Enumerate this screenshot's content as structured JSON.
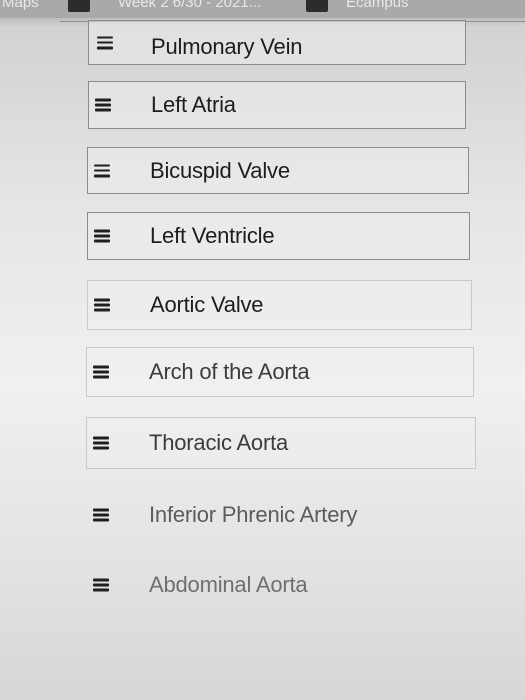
{
  "bookmarks_bar": {
    "items": [
      "Maps",
      "Week 2 6/30 - 2021...",
      "Ecampus"
    ]
  },
  "sortable_list": {
    "items": [
      {
        "label": "Pulmonary Vein"
      },
      {
        "label": "Left Atria"
      },
      {
        "label": "Bicuspid Valve"
      },
      {
        "label": "Left Ventricle"
      },
      {
        "label": "Aortic Valve"
      },
      {
        "label": "Arch of the Aorta"
      },
      {
        "label": "Thoracic Aorta"
      },
      {
        "label": "Inferior Phrenic Artery"
      },
      {
        "label": "Abdominal Aorta"
      }
    ],
    "handle_icon": "drag-handle-icon"
  },
  "colors": {
    "text": "#1d1d1d",
    "border": "#8c8c8c",
    "handle": "#1f1f1f"
  }
}
